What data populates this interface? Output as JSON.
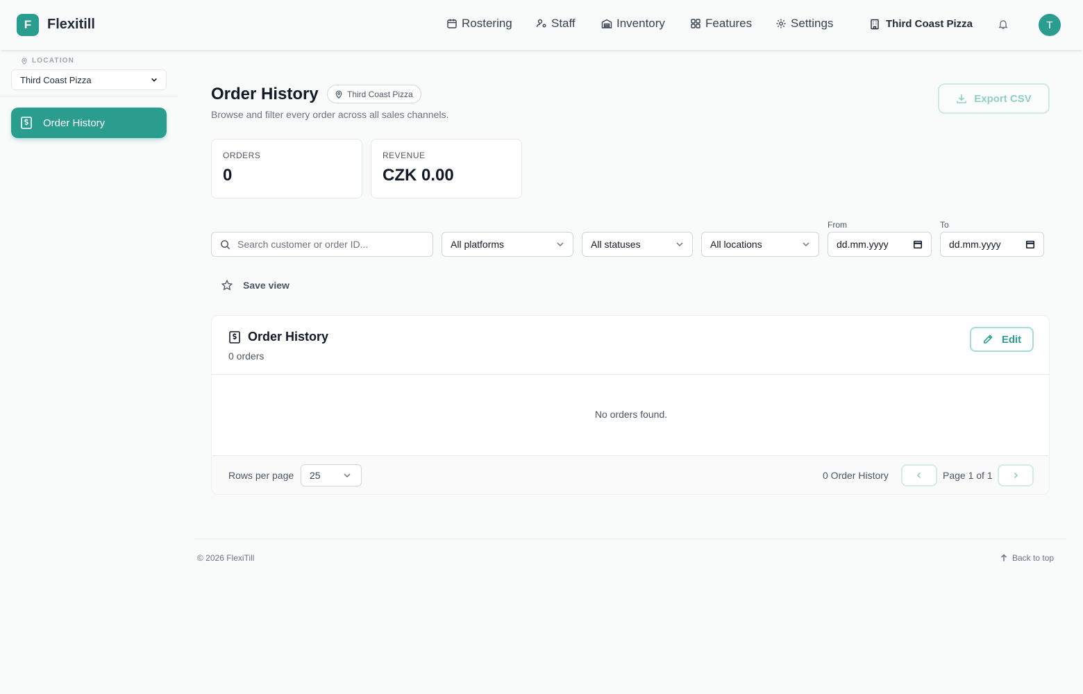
{
  "app": {
    "logo_letter": "F",
    "brand": "Flexitill"
  },
  "nav": {
    "items": [
      {
        "label": "Rostering",
        "icon": "calendar-icon"
      },
      {
        "label": "Staff",
        "icon": "user-cog-icon"
      },
      {
        "label": "Inventory",
        "icon": "warehouse-icon"
      },
      {
        "label": "Features",
        "icon": "grid-icon"
      },
      {
        "label": "Settings",
        "icon": "gear-icon"
      }
    ],
    "store": "Third Coast Pizza",
    "avatar_letter": "T"
  },
  "sidebar": {
    "location_label": "LOCATION",
    "location_value": "Third Coast Pizza",
    "items": [
      {
        "label": "Order History",
        "icon": "receipt-icon",
        "active": true
      }
    ]
  },
  "main": {
    "title": "Order History",
    "location_chip": "Third Coast Pizza",
    "subtitle": "Browse and filter every order across all sales channels.",
    "export_label": "Export CSV",
    "stats": [
      {
        "label": "ORDERS",
        "value": "0"
      },
      {
        "label": "REVENUE",
        "value": "CZK 0.00"
      }
    ],
    "filters": {
      "search_placeholder": "Search customer or order ID...",
      "platform": "All platforms",
      "status": "All statuses",
      "location": "All locations",
      "from_label": "From",
      "from_value": "dd.mm.yyyy",
      "to_label": "To",
      "to_value": "dd.mm.yyyy"
    },
    "save_view_label": "Save view",
    "table": {
      "title": "Order History",
      "count": "0 orders",
      "edit_label": "Edit",
      "empty_text": "No orders found.",
      "rows_per_page_label": "Rows per page",
      "rows_per_page": "25",
      "total_label": "0 Order History",
      "page_label": "Page 1 of 1"
    }
  },
  "footer": {
    "copyright": "© 2026 FlexiTill",
    "back_to_top": "Back to top"
  },
  "colors": {
    "accent": "#2a9d8f",
    "background": "#f9fafa"
  }
}
